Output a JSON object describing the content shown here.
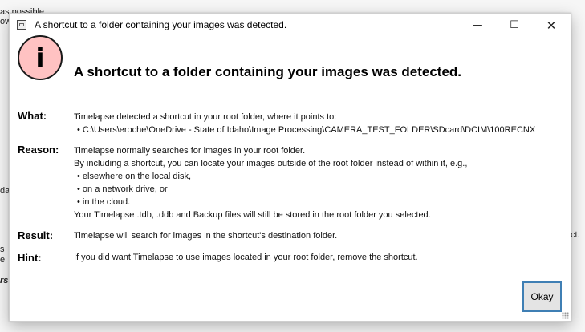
{
  "background": {
    "fragments": [
      "as possible",
      "ow",
      "da",
      "ct.",
      "s",
      "e",
      "rs"
    ]
  },
  "dialog": {
    "window_title": "A shortcut to a folder containing your images was detected.",
    "headline": "A shortcut to a folder containing your images was detected.",
    "icon_glyph": "i",
    "controls": {
      "minimize": "—",
      "maximize": "☐",
      "close": "✕"
    },
    "what": {
      "label": "What:",
      "text": "Timelapse detected a shortcut in your root folder, where it points to:",
      "bullets": [
        "• C:\\Users\\eroche\\OneDrive - State of Idaho\\Image Processing\\CAMERA_TEST_FOLDER\\SDcard\\DCIM\\100RECNX"
      ]
    },
    "reason": {
      "label": "Reason:",
      "lines": [
        "Timelapse normally searches for images in your root folder.",
        "By including a shortcut, you can locate your images outside of the root folder instead of within it, e.g.,"
      ],
      "bullets": [
        "• elsewhere on the local disk,",
        "• on a network drive, or",
        "• in the cloud."
      ],
      "footer": "Your Timelapse .tdb, .ddb and Backup files will still be stored in the root folder you selected."
    },
    "result": {
      "label": "Result:",
      "text": "Timelapse will search for images in the shortcut's destination folder."
    },
    "hint": {
      "label": "Hint:",
      "text": "If you did want Timelapse to use images located in your root folder, remove the shortcut."
    },
    "okay_label": "Okay"
  }
}
